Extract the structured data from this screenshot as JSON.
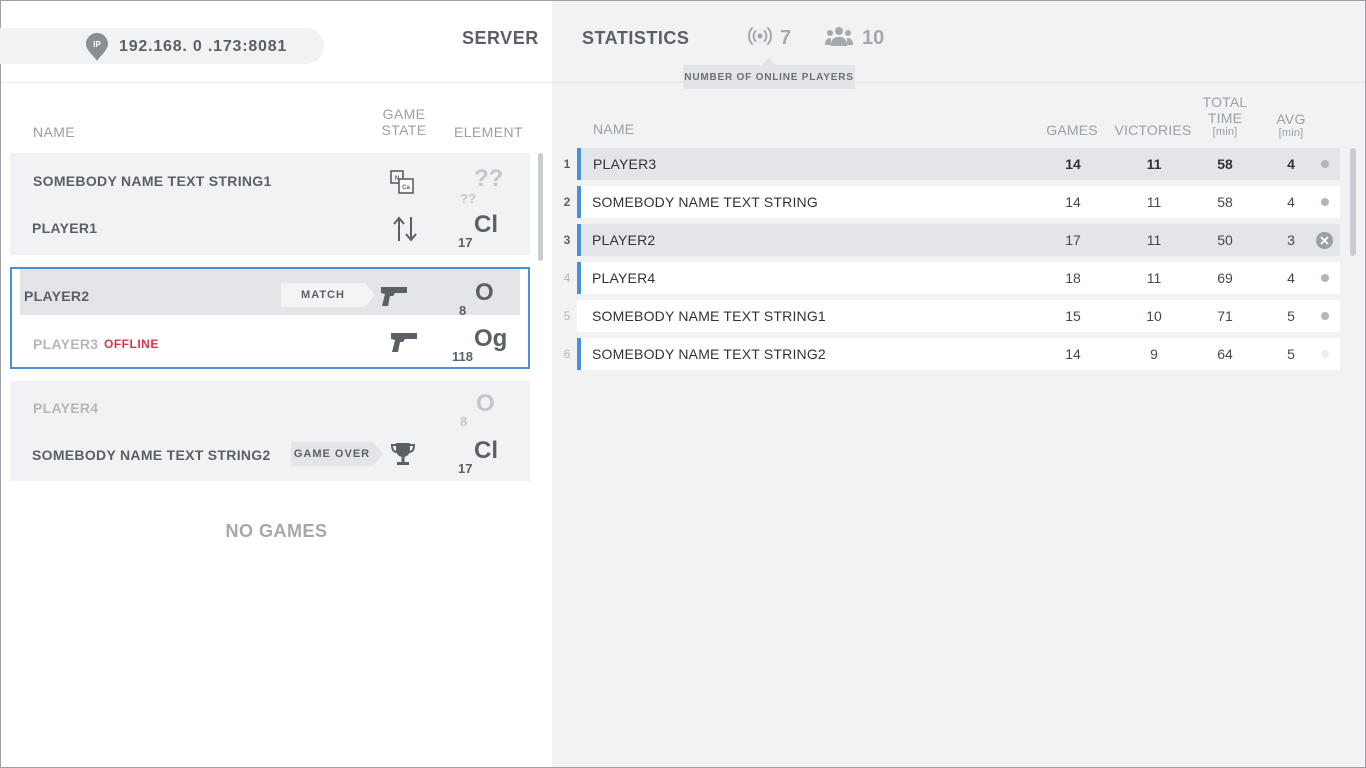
{
  "server": {
    "ip_badge": "IP",
    "ip_address": "192.168. 0 .173:8081",
    "nav_label": "SERVER"
  },
  "games_table": {
    "headers": {
      "name": "NAME",
      "game_state": "GAME STATE",
      "element": "ELEMENT"
    },
    "games": [
      {
        "players": [
          {
            "name": "SOMEBODY NAME TEXT STRING1",
            "state_icon": "periodic-table-icon",
            "element_symbol": "??",
            "element_number": "??",
            "dim": true
          },
          {
            "name": "PLAYER1",
            "state_icon": "swap-arrows-icon",
            "element_symbol": "Cl",
            "element_number": "17"
          }
        ]
      },
      {
        "selected": true,
        "players": [
          {
            "name": "PLAYER2",
            "tag": "MATCH",
            "state_icon": "pistol-icon",
            "element_symbol": "O",
            "element_number": "8"
          },
          {
            "name": "PLAYER3",
            "status": "OFFLINE",
            "state_icon": "pistol-icon",
            "element_symbol": "Og",
            "element_number": "118"
          }
        ]
      },
      {
        "players": [
          {
            "name": "PLAYER4",
            "element_symbol": "O",
            "element_number": "8",
            "dim": true
          },
          {
            "name": "SOMEBODY NAME TEXT STRING2",
            "tag": "GAME OVER",
            "state_icon": "trophy-icon",
            "element_symbol": "Cl",
            "element_number": "17"
          }
        ]
      }
    ],
    "empty_label": "NO GAMES"
  },
  "statistics": {
    "nav_label": "STATISTICS",
    "online_count": "7",
    "players_count": "10",
    "tooltip": "NUMBER OF ONLINE PLAYERS",
    "headers": {
      "name": "NAME",
      "games": "GAMES",
      "victories": "VICTORIES",
      "total_time": "TOTAL TIME",
      "total_time_unit": "[min]",
      "avg": "AVG",
      "avg_unit": "[min]"
    },
    "rows": [
      {
        "rank": "1",
        "name": "PLAYER3",
        "games": "14",
        "victories": "11",
        "total_time": "58",
        "avg": "4",
        "status": "online"
      },
      {
        "rank": "2",
        "name": "SOMEBODY NAME TEXT STRING",
        "games": "14",
        "victories": "11",
        "total_time": "58",
        "avg": "4",
        "status": "online"
      },
      {
        "rank": "3",
        "name": "PLAYER2",
        "games": "17",
        "victories": "11",
        "total_time": "50",
        "avg": "3",
        "status": "remove"
      },
      {
        "rank": "4",
        "name": "PLAYER4",
        "games": "18",
        "victories": "11",
        "total_time": "69",
        "avg": "4",
        "status": "online"
      },
      {
        "rank": "5",
        "name": "SOMEBODY NAME TEXT STRING1",
        "games": "15",
        "victories": "10",
        "total_time": "71",
        "avg": "5",
        "status": "online"
      },
      {
        "rank": "6",
        "name": "SOMEBODY NAME TEXT STRING2",
        "games": "14",
        "victories": "9",
        "total_time": "64",
        "avg": "5",
        "status": "offline"
      }
    ]
  },
  "colors": {
    "accent": "#4a90d9",
    "offline": "#e0344f",
    "panel": "#f1f2f4",
    "text": "#5b6066"
  }
}
